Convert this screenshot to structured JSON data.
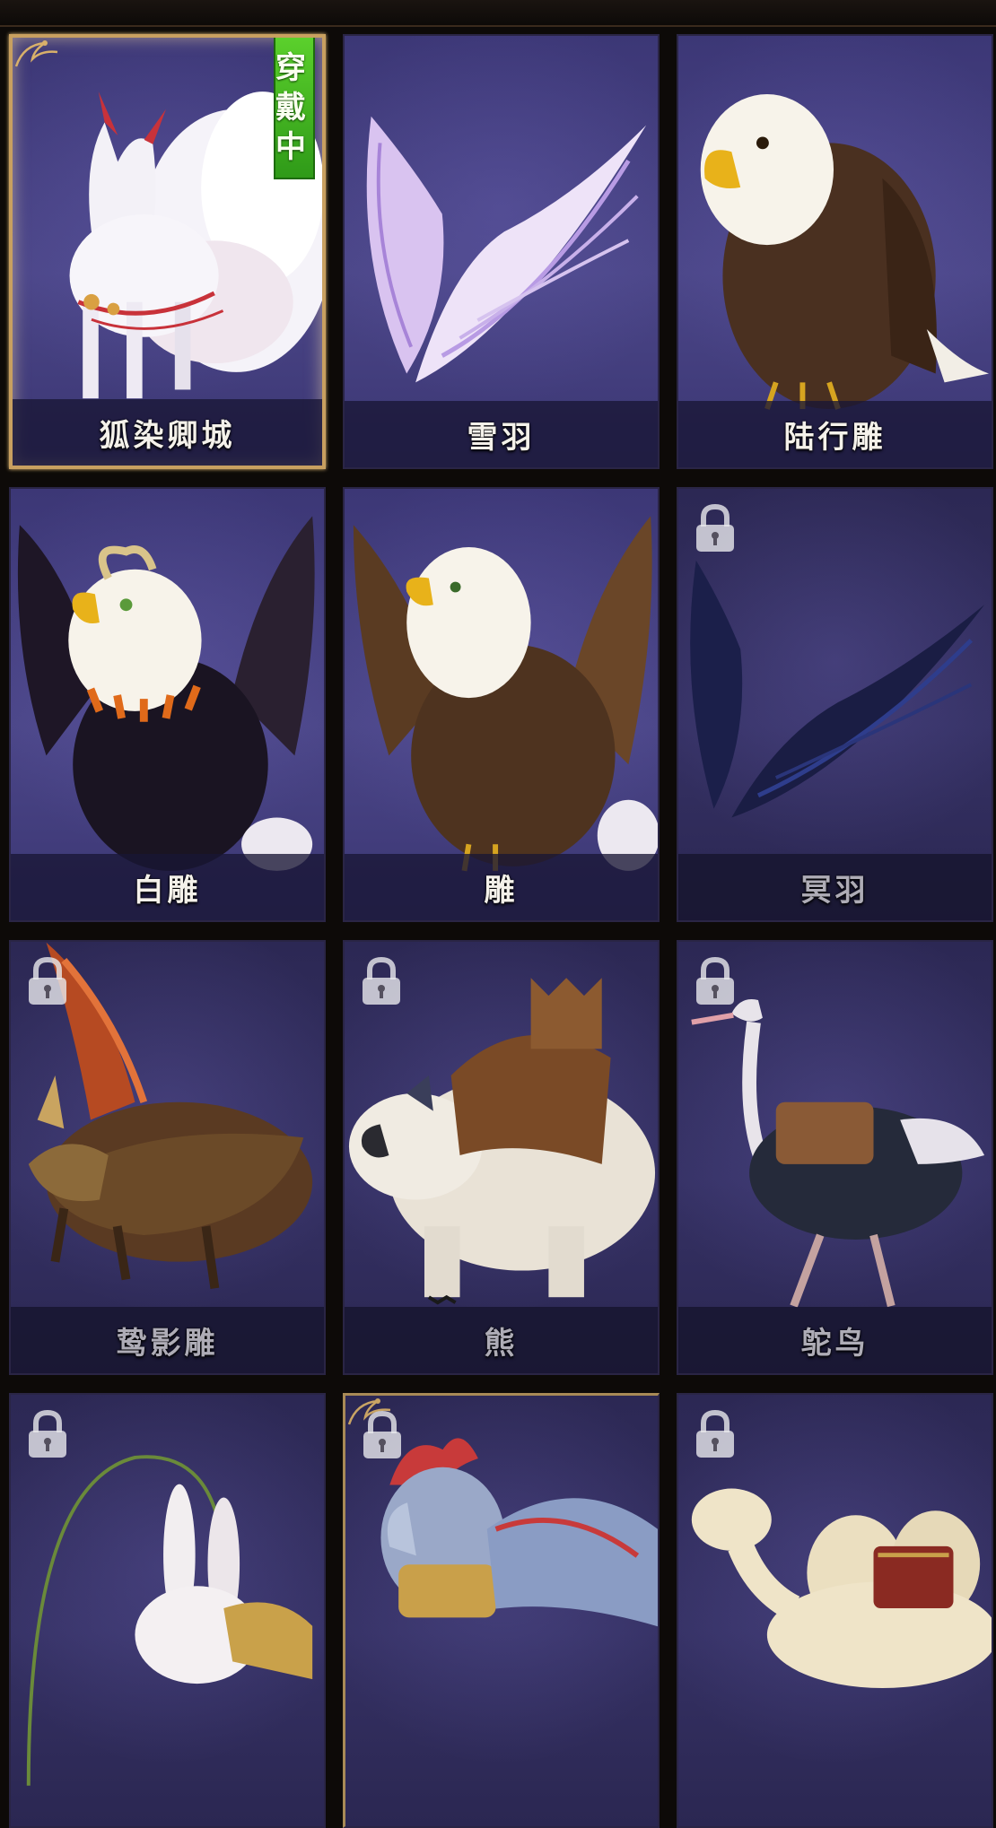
{
  "mount_grid": {
    "equipped_badge_label": "穿戴中",
    "mounts": [
      {
        "name": "狐染卿城",
        "state": "equipped",
        "art": "nine-tailed-fox",
        "colors": {
          "body": "#f4f2f7",
          "accent": "#c8323a"
        }
      },
      {
        "name": "雪羽",
        "state": "unlocked",
        "art": "lilac-wings",
        "colors": {
          "body": "#e3d2f2",
          "accent": "#b28be0"
        }
      },
      {
        "name": "陆行雕",
        "state": "unlocked",
        "art": "walking-eagle",
        "colors": {
          "body": "#4a3020",
          "accent": "#f7f3ea"
        }
      },
      {
        "name": "白雕",
        "state": "unlocked",
        "art": "horned-eagle",
        "colors": {
          "body": "#1e1626",
          "accent": "#f7f3ea"
        }
      },
      {
        "name": "雕",
        "state": "unlocked",
        "art": "griffin-eagle",
        "colors": {
          "body": "#4e331f",
          "accent": "#f7f3ea"
        }
      },
      {
        "name": "冥羽",
        "state": "locked",
        "art": "dark-wings",
        "colors": {
          "body": "#1b1f4a",
          "accent": "#2e3d8c"
        }
      },
      {
        "name": "鸷影雕",
        "state": "locked",
        "art": "armored-griffin",
        "colors": {
          "body": "#5a3a22",
          "accent": "#c84a2a"
        }
      },
      {
        "name": "熊",
        "state": "locked",
        "art": "armored-bear",
        "colors": {
          "body": "#e9e2d6",
          "accent": "#7a4a26"
        }
      },
      {
        "name": "鸵鸟",
        "state": "locked",
        "art": "ostrich",
        "colors": {
          "body": "#252a3a",
          "accent": "#8a5a36"
        }
      },
      {
        "name": "",
        "state": "locked",
        "art": "rabbit",
        "colors": {
          "body": "#f2eef0",
          "accent": "#c9a14a"
        }
      },
      {
        "name": "",
        "state": "locked-special",
        "art": "armored-horse",
        "colors": {
          "body": "#9aa8c8",
          "accent": "#c83a3a"
        }
      },
      {
        "name": "",
        "state": "locked",
        "art": "camel",
        "colors": {
          "body": "#efe4c8",
          "accent": "#8a2a22"
        }
      }
    ]
  }
}
